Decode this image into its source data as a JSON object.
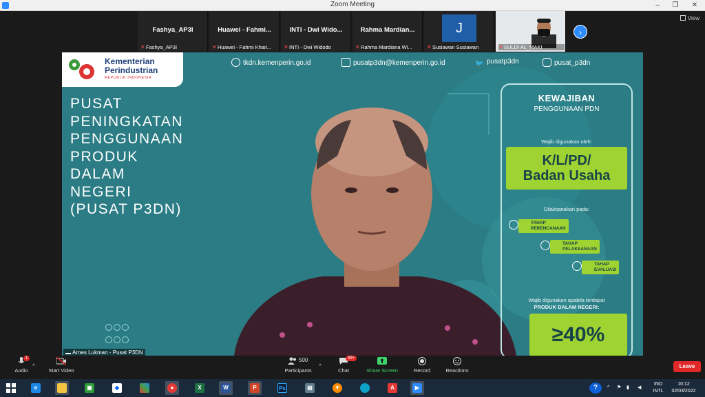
{
  "window": {
    "title": "Zoom Meeting",
    "view_label": "View"
  },
  "participants": [
    {
      "name": "Fashya_AP3I",
      "subname": "Fashya_AP3I",
      "type": "name"
    },
    {
      "name": "Huawei - Fahmi...",
      "subname": "Huawei - Fahmi Khair...",
      "type": "name"
    },
    {
      "name": "INTI - Dwi Wido...",
      "subname": "INTI - Dwi Widodo",
      "type": "name"
    },
    {
      "name": "Rahma  Mardian...",
      "subname": "Rahma Mardiana Wi...",
      "type": "name"
    },
    {
      "name": "J",
      "subname": "Susiawan Susiawan",
      "type": "initial"
    },
    {
      "name": "",
      "subname": "SULDI AL_MAKI",
      "type": "video"
    }
  ],
  "slide": {
    "logo": {
      "line1": "Kementerian",
      "line2": "Perindustrian",
      "line3": "REPUBLIK INDONESIA"
    },
    "contacts": [
      "tkdn.kemenperin.go.id",
      "pusatp3dn@kemenperin.go.id",
      "pusatp3dn",
      "pusat_p3dn"
    ],
    "title_lines": [
      "PUSAT",
      "PENINGKATAN",
      "PENGGUNAAN",
      "PRODUK",
      "DALAM",
      "NEGERI",
      "(PUSAT P3DN)"
    ],
    "panel": {
      "title": "KEWAJIBAN",
      "subtitle": "PENGGUNAAN PDN",
      "used_by_label": "Wajib digunakan oleh:",
      "used_by_value_1": "K/L/PD/",
      "used_by_value_2": "Badan Usaha",
      "executed_label": "Dilaksanakan pada:",
      "steps": [
        {
          "l1": "TAHAP",
          "l2": "PERENCANAAN"
        },
        {
          "l1": "TAHAP",
          "l2": "PELAKSANAAN"
        },
        {
          "l1": "TAHAP",
          "l2": "EVALUASI"
        }
      ],
      "condition_label_1": "Wajib digunakan apabila terdapat",
      "condition_label_2": "PRODUK DALAM NEGERI:",
      "threshold": "≥40%"
    }
  },
  "speaker_name": "Arnes Lukman - Pusat P3DN",
  "controls": {
    "audio": "Audio",
    "audio_badge": "1",
    "start_video": "Start Video",
    "participants": "Participants",
    "participants_count": "500",
    "chat": "Chat",
    "chat_badge": "99+",
    "share_screen": "Share Screen",
    "record": "Record",
    "reactions": "Reactions",
    "leave": "Leave"
  },
  "taskbar": {
    "lang_top": "IND",
    "lang_bottom": "INTL",
    "time": "10:12",
    "date": "02/03/2022"
  },
  "colors": {
    "slide_bg": "#2a7a82",
    "accent_green": "#9fd331",
    "zoom_blue": "#2d8cff",
    "leave_red": "#e02828"
  }
}
